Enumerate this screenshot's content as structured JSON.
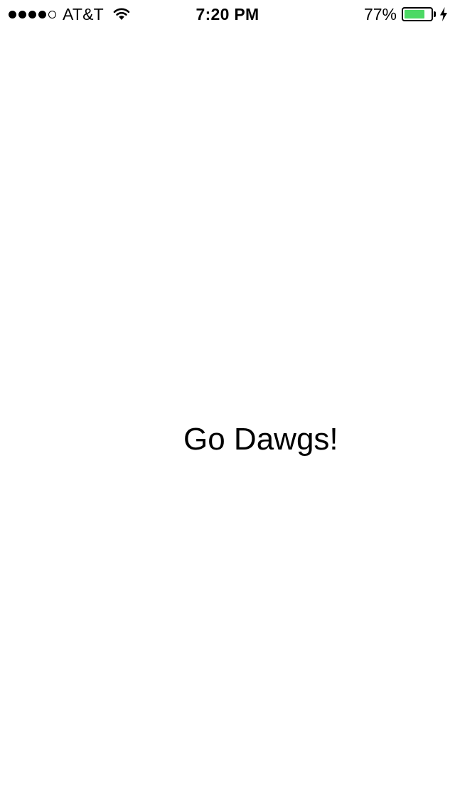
{
  "status_bar": {
    "signal_bars": 5,
    "signal_filled": 4,
    "carrier": "AT&T",
    "wifi_icon": "wifi-icon",
    "time": "7:20 PM",
    "battery_percent": "77%",
    "battery_level": 0.77,
    "battery_color": "#4cd964",
    "charging_icon": "charging-bolt-icon"
  },
  "main": {
    "label": "Go Dawgs!"
  }
}
